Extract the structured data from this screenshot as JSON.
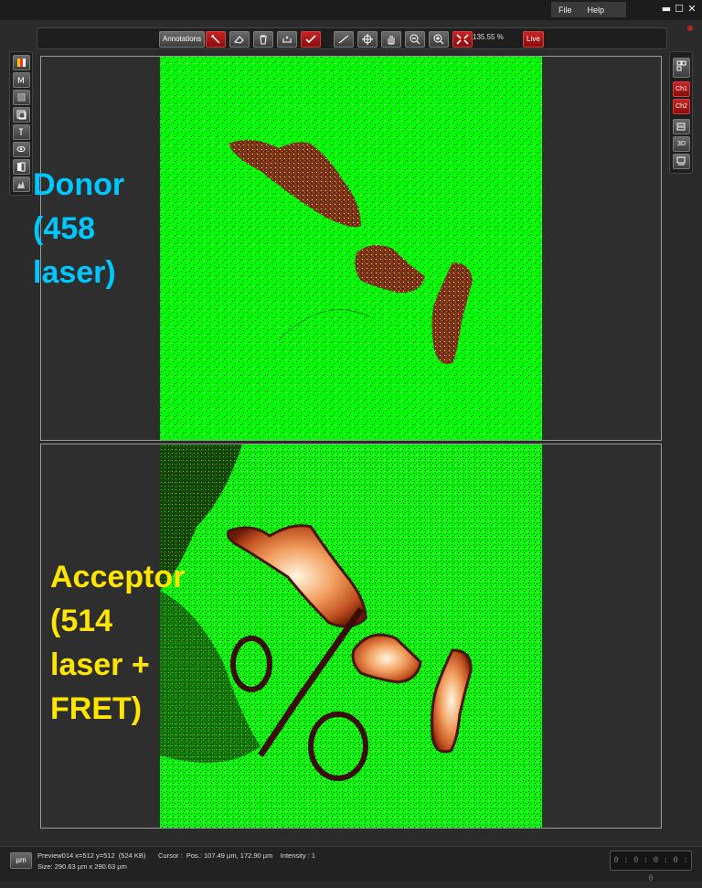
{
  "menu": {
    "file": "File",
    "help": "Help"
  },
  "window_controls": {
    "minimize": "▬",
    "maximize": "☐",
    "close": "✕"
  },
  "toolbar": {
    "annotations_label": "Annotations",
    "zoom_value": "135.55 %",
    "live_label": "Live",
    "icons": [
      "draw-icon",
      "erase-icon",
      "trash-icon",
      "line-profile-icon",
      "check-icon",
      "measure-icon",
      "crosshair-icon",
      "pan-hand-icon",
      "zoom-out-icon",
      "zoom-in-icon",
      "fit-to-window-icon"
    ]
  },
  "left_panel": {
    "icons": [
      "color-bars-icon",
      "mode-icon",
      "layers-icon",
      "image-stack-icon",
      "info-icon",
      "eye-icon",
      "split-icon",
      "histogram-icon"
    ]
  },
  "right_panel": {
    "layout_icon": "layout-grid-icon",
    "channel_1": "Ch1",
    "channel_2": "Ch2",
    "channel_3d": "3D",
    "icons": [
      "gallery-icon",
      "export-icon"
    ]
  },
  "overlays": {
    "donor": "Donor\n(458\nlaser)",
    "acceptor": "Acceptor\n(514\nlaser +\nFRET)"
  },
  "colors": {
    "donor_label": "#00c8ff",
    "acceptor_label": "#ffe500",
    "background_channel": "#00ff00",
    "accent_red": "#b41414"
  },
  "status": {
    "unit_button": "µm",
    "image_info": "Preview014 x=512 y=512  (524 KB)",
    "cursor": "Cursor :  Pos.: 107.49 µm, 172.90 µm    Intensity : 1",
    "size": "Size: 290.63 µm x 290.63 µm",
    "timer": "0 : 0 : 0 : 0 : 0"
  }
}
